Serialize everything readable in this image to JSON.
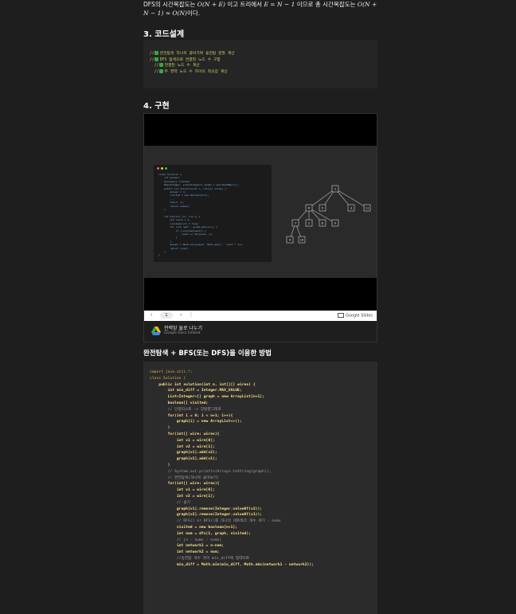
{
  "intro": {
    "line1_prefix": "DFS의 시간복잡도는 ",
    "line1_math": "O(N + E)",
    "line1_mid": " 이고 트리에서 ",
    "line1_math2": "E = N − 1",
    "line1_suffix": " 이므로 총 시간복잡도는 ",
    "line1_math3": "O(N +",
    "line2_math": "N − 1) ≈ O(N)",
    "line2_suffix": "이다."
  },
  "section3": {
    "title": "3. 코드설계",
    "lines": [
      "완전탐색 하나씩 끊어가며 송전탑 분할 계산",
      "DFS 탐색으로 연결된 노드 수 구함",
      "연결된 노드 수 계산",
      "두 영역 노드 수 차이의 최솟값 계산"
    ]
  },
  "section4": {
    "title": "4. 구현"
  },
  "slides": {
    "page": "1",
    "prev": "‹",
    "next": "›",
    "more": "⋮",
    "brand": "Google Slides",
    "doc_title": "전력망 둘로 나누기",
    "doc_sub": "Google Docs Embed",
    "tree_nodes": [
      "1",
      "6",
      "5",
      "3",
      "11",
      "7",
      "2",
      "8",
      "9",
      "4",
      "10"
    ]
  },
  "method": {
    "title": "완전탐색 + BFS(또는 DFS)을 이용한 방법"
  },
  "code": [
    "import java.util.*;",
    "class Solution {",
    "    public int solution(int n, int[][] wires) {",
    "        int min_diff = Integer.MAX_VALUE;",
    "        List<Integer>[] graph = new ArrayList[n+1];",
    "        boolean[] visited;",
    "        // 인접리스트 -> 양방향그래프",
    "        for(int i = 0; i < n+1; i++){",
    "            graph[i] = new ArrayList<>();",
    "        }",
    "        for(int[] wire: wires){",
    "            int v1 = wire[0];",
    "            int v2 = wire[1];",
    "            graph[v1].add(v2);",
    "            graph[v2].add(v1);",
    "        }",
    "        // System.out.println(Arrays.toString(graph));",
    "        // 완전탐색(하나씩 끊어보기)",
    "        for(int[] wire: wires){",
    "            int v1 = wire[0];",
    "            int v2 = wire[1];",
    "            // 끊기",
    "            graph[v1].remove(Integer.valueOf(v2));",
    "            graph[v2].remove(Integer.valueOf(v1));",
    "",
    "            // DFS() or BFS()를 하나의 네트워크 개수 세기 - nums",
    "            visited = new boolean[n+1];",
    "            int num = dfs(1, graph, visited);",
    "",
    "            // |n - nums - nums|",
    "            int network1 = n-num;",
    "            int network2 = num;",
    "",
    "            //송전탑 개수 차이 min_diff에 업데이트",
    "            min_diff = Math.min(min_diff, Math.abs(network1 - network2));"
  ]
}
